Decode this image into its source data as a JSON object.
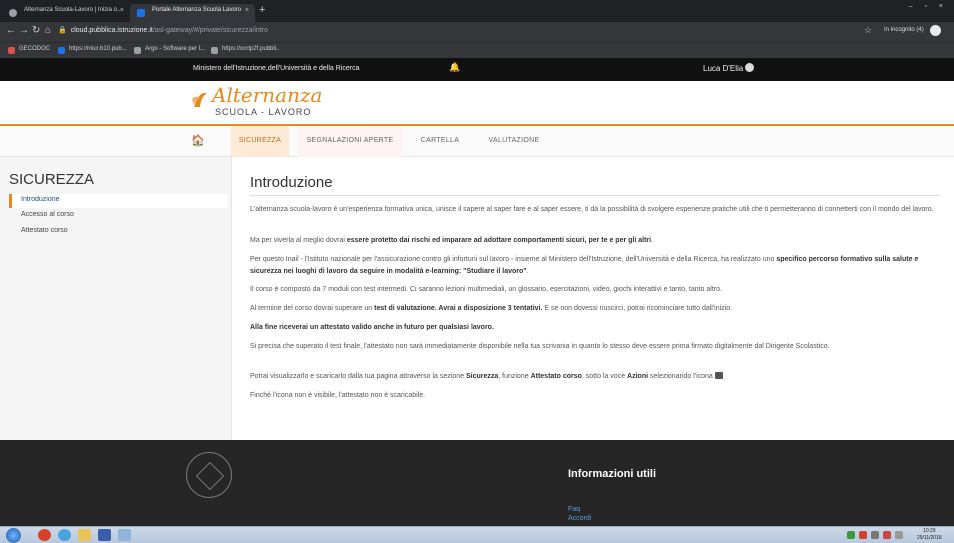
{
  "browser": {
    "tabs": [
      {
        "title": "Alternanza Scuola-Lavoro | Inizia o..."
      },
      {
        "title": "Portale Alternanza Scuola Lavoro"
      }
    ],
    "close_glyph": "×",
    "new_tab_glyph": "+",
    "window_controls": "– ▫ ×",
    "nav_icons": [
      "arrow-left-icon",
      "arrow-right-icon",
      "reload-icon",
      "home-icon"
    ],
    "url_host": "cloud.pubblica.istruzione.it",
    "url_path": "/asl-gateway/#/private/sicurezza/intro",
    "star_glyph": "☆",
    "incognito_label": "In incognito (4)",
    "bookmarks": [
      {
        "label": "GECODOC"
      },
      {
        "label": "https://miur.b10.pub..."
      },
      {
        "label": "Argo - Software per l..."
      },
      {
        "label": "https://ocrtp2f.pubbli.."
      }
    ]
  },
  "site": {
    "ministry": "Ministero dell'Istruzione,dell'Università e della Ricerca",
    "bell_glyph": "🔔",
    "user_name": "Luca D'Elia",
    "logo_title": "Alternanza",
    "logo_subtitle": "SCUOLA - LAVORO",
    "home_glyph": "🏠",
    "nav": [
      {
        "label": "SICUREZZA"
      },
      {
        "label": "SEGNALAZIONI APERTE"
      },
      {
        "label": "CARTELLA"
      },
      {
        "label": "VALUTAZIONE"
      }
    ],
    "accent_color": "#e8891d"
  },
  "sidebar": {
    "title": "SICUREZZA",
    "items": [
      {
        "label": "Introduzione"
      },
      {
        "label": "Accesso al corso"
      },
      {
        "label": "Attestato corso"
      }
    ]
  },
  "content": {
    "title": "Introduzione",
    "p1": "L'alternanza scuola-lavoro è un'esperienza formativa unica, unisce il sapere al saper fare e al saper essere, ti dà la possibilità di svolgere esperienze pratiche utili che ti permetteranno di connetterti con il mondo del lavoro.",
    "p2_a": "Ma per viverla al meglio dovrai ",
    "p2_b": "essere protetto dai rischi ed imparare ad adottare comportamenti sicuri, per te e per gli altri",
    "p2_c": ".",
    "p3_a": "Per questo Inail - l'Istituto nazionale per l'assicurazione contro gli infortuni sul lavoro - insieme al Ministero dell'Istruzione, dell'Università e della Ricerca, ha realizzato uno ",
    "p3_b": "specifico percorso formativo sulla salute e sicurezza nei luoghi di lavoro da seguire in modalità e-learning: \"Studiare il lavoro\"",
    "p3_c": ".",
    "p4": "Il corso è composto da 7 moduli con test intermedi. Ci saranno lezioni multimediali, un glossario, esercitazioni, video, giochi interattivi e tanto, tanto altro.",
    "p5_a": "Al termine del corso dovrai superare un ",
    "p5_b": "test di valutazione. Avrai a disposizione 3 tentativi.",
    "p5_c": " E se non dovessi riuscirci, potrai ricominciare tutto dall'inizio.",
    "p6": "Alla fine riceverai un attestato valido anche in futuro per qualsiasi lavoro.",
    "p7": "Si precisa che superato il test finale, l'attestato non sarà immediatamente disponibile nella tua scrivania in quanto lo stesso deve essere prima firmato digitalmente dal Dirigente Scolastico.",
    "p8_a": "Potrai visualizzarlo e scaricarlo dalla tua pagina attraverso la sezione ",
    "p8_b": "Sicurezza",
    "p8_c": ", funzione ",
    "p8_d": "Attestato corso",
    "p8_e": ", sotto la voce ",
    "p8_f": "Azioni",
    "p8_g": " selezionando l'icona ",
    "p9": "Finché l'icona non è visibile, l'attestato non è scaricabile."
  },
  "footer": {
    "title": "Informazioni utili",
    "links": [
      {
        "label": "Faq"
      },
      {
        "label": "Accordi"
      }
    ]
  },
  "taskbar": {
    "clock_time": "10:29",
    "clock_date": "29/11/2018"
  }
}
